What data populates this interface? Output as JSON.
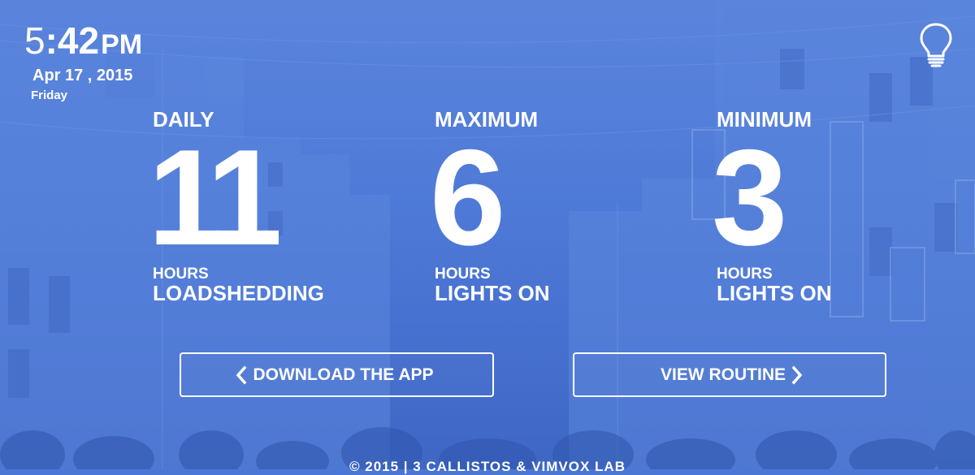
{
  "clock": {
    "hour": "5",
    "colon": ":",
    "minutes": "42",
    "ampm": "PM",
    "date": "Apr 17 , 2015",
    "weekday": "Friday"
  },
  "stats": {
    "daily": {
      "label": "DAILY",
      "value": "11",
      "unit": "HOURS",
      "desc": "LOADSHEDDING"
    },
    "maximum": {
      "label": "MAXIMUM",
      "value": "6",
      "unit": "HOURS",
      "desc": "LIGHTS ON"
    },
    "minimum": {
      "label": "MINIMUM",
      "value": "3",
      "unit": "HOURS",
      "desc": "LIGHTS ON"
    }
  },
  "buttons": {
    "download": "DOWNLOAD THE APP",
    "routine": "VIEW ROUTINE"
  },
  "footer": "© 2015 | 3 CALLISTOS & VIMVOX LAB",
  "icons": {
    "bulb": "lightbulb-icon",
    "left": "chevron-left-icon",
    "right": "chevron-right-icon"
  },
  "colors": {
    "overlay": "#4a77d6",
    "text": "#ffffff"
  }
}
